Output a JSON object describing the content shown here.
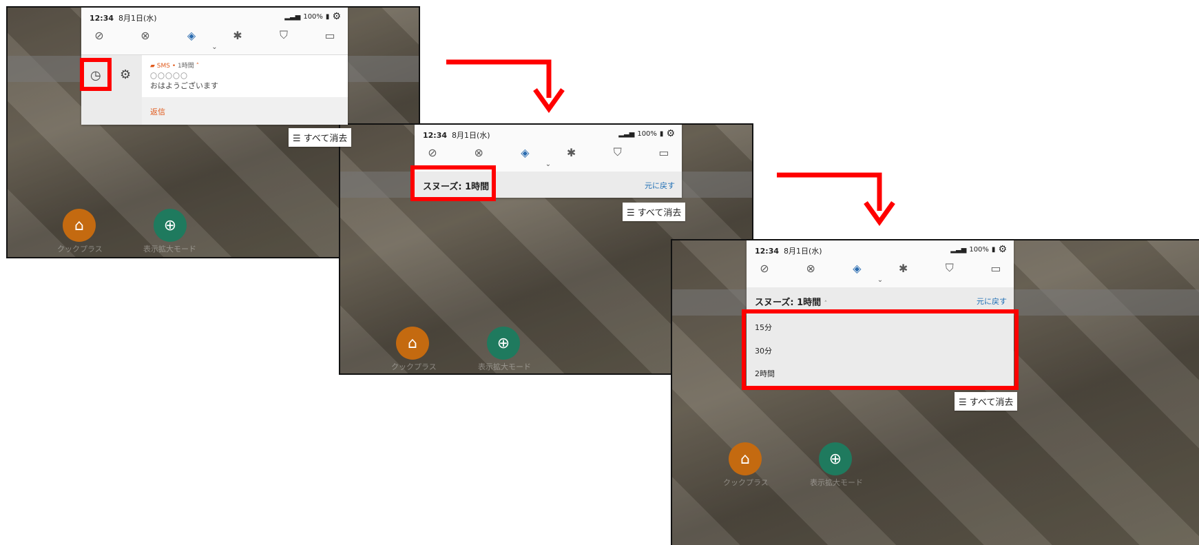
{
  "status": {
    "time": "12:34",
    "date": "8月1日(水)",
    "battery": "100%"
  },
  "notification": {
    "app": "SMS",
    "age": "1時間",
    "sender": "〇〇〇〇〇",
    "message": "おはようございます",
    "reply": "返信"
  },
  "snooze": {
    "label": "スヌーズ: 1時間",
    "undo": "元に戻す",
    "options": [
      "15分",
      "30分",
      "2時間"
    ]
  },
  "clear_all": "すべて消去",
  "apps": [
    {
      "label": "クックプラス"
    },
    {
      "label": "表示拡大モード"
    }
  ],
  "icons": {
    "quick_settings": [
      "wifi-off-icon",
      "data-saver-icon",
      "auto-rotate-icon",
      "bluetooth-off-icon",
      "shield-icon",
      "cast-icon"
    ]
  },
  "colors": {
    "highlight": "#ff0000",
    "accent": "#2b6cb0",
    "sms": "#e05a1c",
    "cook_app": "#d9730d",
    "zoom_app": "#1f8a68"
  }
}
